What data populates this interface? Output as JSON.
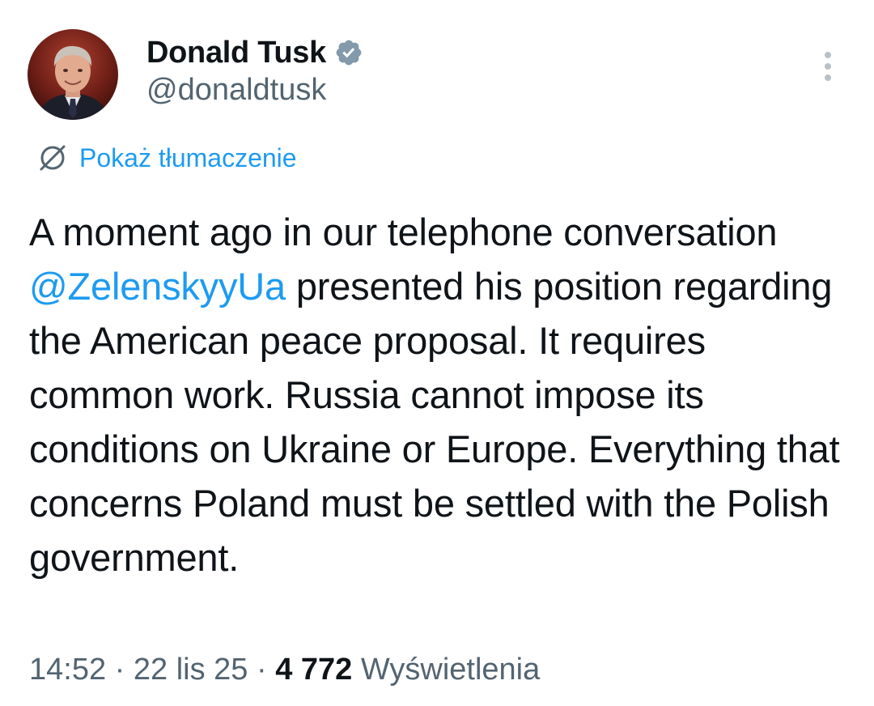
{
  "author": {
    "display_name": "Donald Tusk",
    "handle": "@donaldtusk",
    "avatar_icon": "profile-photo",
    "verified_icon": "verified-badge-icon",
    "verified_color": "#829aab"
  },
  "actions": {
    "more_icon": "vertical-ellipsis-icon"
  },
  "translate": {
    "icon": "translate-globe-icon",
    "label": "Pokaż tłumaczenie"
  },
  "tweet": {
    "text_before_mention": "A moment ago in our  telephone conversation ",
    "mention": "@ZelenskyyUa",
    "text_after_mention": " presented his position regarding the American peace proposal. It requires common work. Russia cannot impose its conditions on Ukraine or Europe. Everything that concerns Poland must be settled with the Polish government."
  },
  "meta": {
    "time": "14:52",
    "separator": " · ",
    "date": "22 lis 25",
    "views_count": "4 772",
    "views_label": "Wyświetlenia"
  },
  "colors": {
    "accent": "#1d9bf0",
    "secondary_text": "#536471",
    "primary_text": "#0f1419"
  }
}
